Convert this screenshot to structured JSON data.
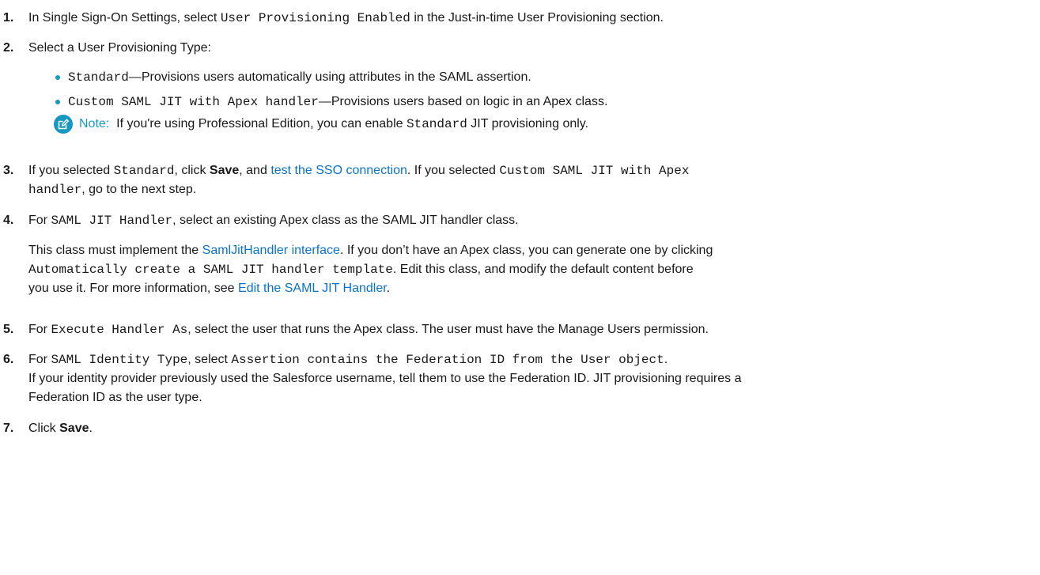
{
  "steps": {
    "s1": {
      "num": "1.",
      "t1": "In Single Sign-On Settings, select",
      "c1": "User Provisioning Enabled",
      "t2": "in the Just-in-time User Provisioning section."
    },
    "s2": {
      "num": "2.",
      "t1": "Select a User Provisioning Type:",
      "bullets": [
        {
          "code": "Standard",
          "text": "—Provisions users automatically using attributes in the SAML assertion."
        },
        {
          "code": "Custom SAML JIT with Apex handler",
          "text": "—Provisions users based on logic in an Apex class."
        }
      ],
      "note": {
        "icon": "edit-note-icon",
        "label": "Note:",
        "t1": "If you're using Professional Edition, you can enable",
        "c1": "Standard",
        "t2": "JIT provisioning only."
      }
    },
    "s3": {
      "num": "3.",
      "t1": "If you selected",
      "c1": "Standard",
      "t2": ", click",
      "b1": "Save",
      "t3": ", and",
      "link1": "test the SSO connection",
      "t4": ". If you selected",
      "c2": "Custom SAML JIT with Apex",
      "c3": "handler",
      "t5": ", go to the next step."
    },
    "s4": {
      "num": "4.",
      "t1": "For",
      "c1": "SAML JIT Handler",
      "t2": ", select an existing Apex class as the SAML JIT handler class.",
      "p1": "This class must implement the",
      "link1": "SamlJitHandler interface",
      "p2": ". If you don’t have an Apex class, you can generate one by clicking",
      "c2": "Automatically create a SAML JIT handler template",
      "p3": ". Edit this class, and modify the default content before",
      "p4": "you use it. For more information, see",
      "link2": "Edit the SAML JIT Handler",
      "p5": "."
    },
    "s5": {
      "num": "5.",
      "t1": "For",
      "c1": "Execute Handler As",
      "t2": ", select the user that runs the Apex class. The user must have the Manage Users permission."
    },
    "s6": {
      "num": "6.",
      "t1": "For",
      "c1": "SAML Identity Type",
      "t2": ", select",
      "c2": "Assertion contains the Federation ID from the User object",
      "t3": ".",
      "l2": "If your identity provider previously used the Salesforce username, tell them to use the Federation ID. JIT provisioning requires a",
      "l3": "Federation ID as the user type."
    },
    "s7": {
      "num": "7.",
      "t1": "Click",
      "b1": "Save",
      "t2": "."
    }
  },
  "colors": {
    "text": "#181818",
    "link": "#0b72c9",
    "accent": "#1798c1"
  }
}
